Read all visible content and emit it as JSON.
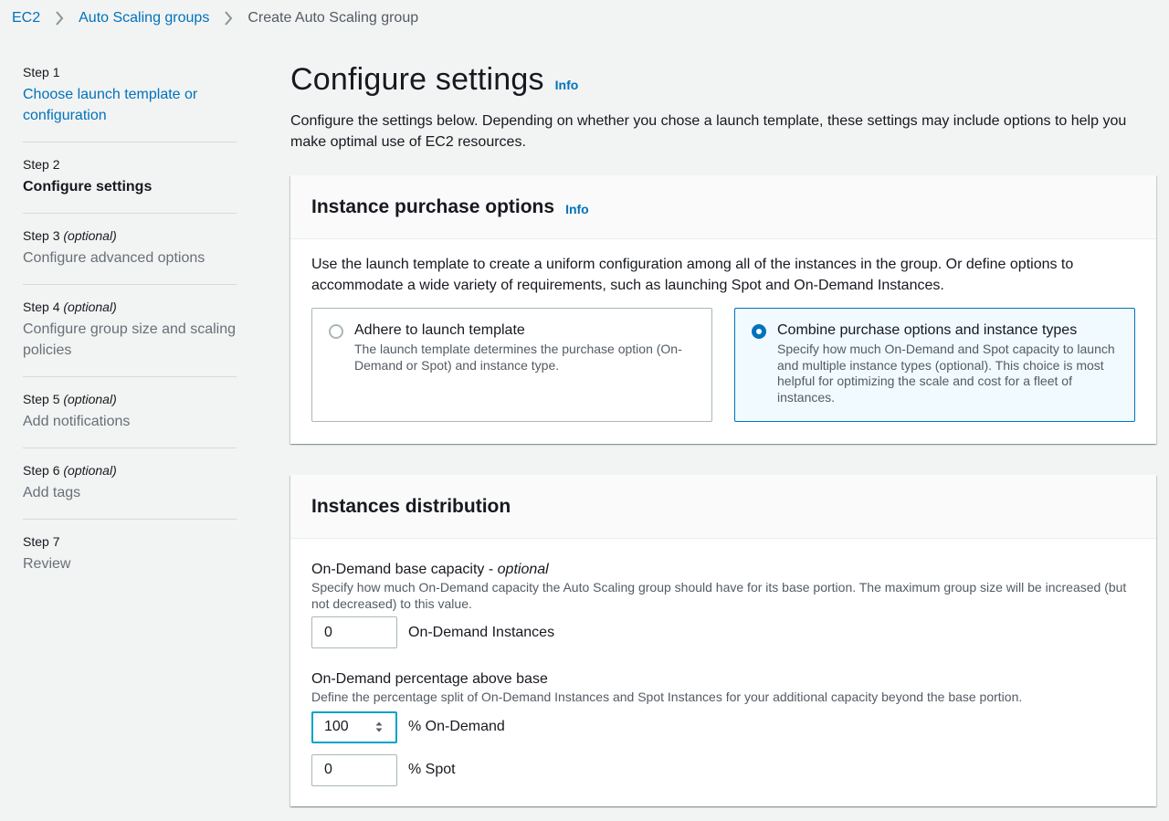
{
  "breadcrumb": {
    "items": [
      "EC2",
      "Auto Scaling groups"
    ],
    "current": "Create Auto Scaling group"
  },
  "steps": [
    {
      "num": "Step 1",
      "optional": "",
      "title": "Choose launch template or configuration",
      "state": "link"
    },
    {
      "num": "Step 2",
      "optional": "",
      "title": "Configure settings",
      "state": "current"
    },
    {
      "num": "Step 3",
      "optional": "(optional)",
      "title": "Configure advanced options",
      "state": "disabled"
    },
    {
      "num": "Step 4",
      "optional": "(optional)",
      "title": "Configure group size and scaling policies",
      "state": "disabled"
    },
    {
      "num": "Step 5",
      "optional": "(optional)",
      "title": "Add notifications",
      "state": "disabled"
    },
    {
      "num": "Step 6",
      "optional": "(optional)",
      "title": "Add tags",
      "state": "disabled"
    },
    {
      "num": "Step 7",
      "optional": "",
      "title": "Review",
      "state": "disabled"
    }
  ],
  "page": {
    "title": "Configure settings",
    "info": "Info",
    "description": "Configure the settings below. Depending on whether you chose a launch template, these settings may include options to help you make optimal use of EC2 resources."
  },
  "purchase_options": {
    "title": "Instance purchase options",
    "info": "Info",
    "description": "Use the launch template to create a uniform configuration among all of the instances in the group. Or define options to accommodate a wide variety of requirements, such as launching Spot and On-Demand Instances.",
    "tiles": [
      {
        "title": "Adhere to launch template",
        "desc": "The launch template determines the purchase option (On-Demand or Spot) and instance type.",
        "selected": false
      },
      {
        "title": "Combine purchase options and instance types",
        "desc": "Specify how much On-Demand and Spot capacity to launch and multiple instance types (optional). This choice is most helpful for optimizing the scale and cost for a fleet of instances.",
        "selected": true
      }
    ]
  },
  "distribution": {
    "title": "Instances distribution",
    "base_capacity": {
      "label": "On-Demand base capacity - ",
      "label_optional": "optional",
      "desc": "Specify how much On-Demand capacity the Auto Scaling group should have for its base portion. The maximum group size will be increased (but not decreased) to this value.",
      "value": "0",
      "suffix": "On-Demand Instances"
    },
    "percentage": {
      "label": "On-Demand percentage above base",
      "desc": "Define the percentage split of On-Demand Instances and Spot Instances for your additional capacity beyond the base portion.",
      "on_demand_value": "100",
      "on_demand_suffix": "% On-Demand",
      "spot_value": "0",
      "spot_suffix": "% Spot"
    }
  },
  "colors": {
    "link": "#0073bb",
    "background": "#f2f3f3",
    "focus": "#00a1c9",
    "selected_tile_bg": "#f1faff"
  }
}
